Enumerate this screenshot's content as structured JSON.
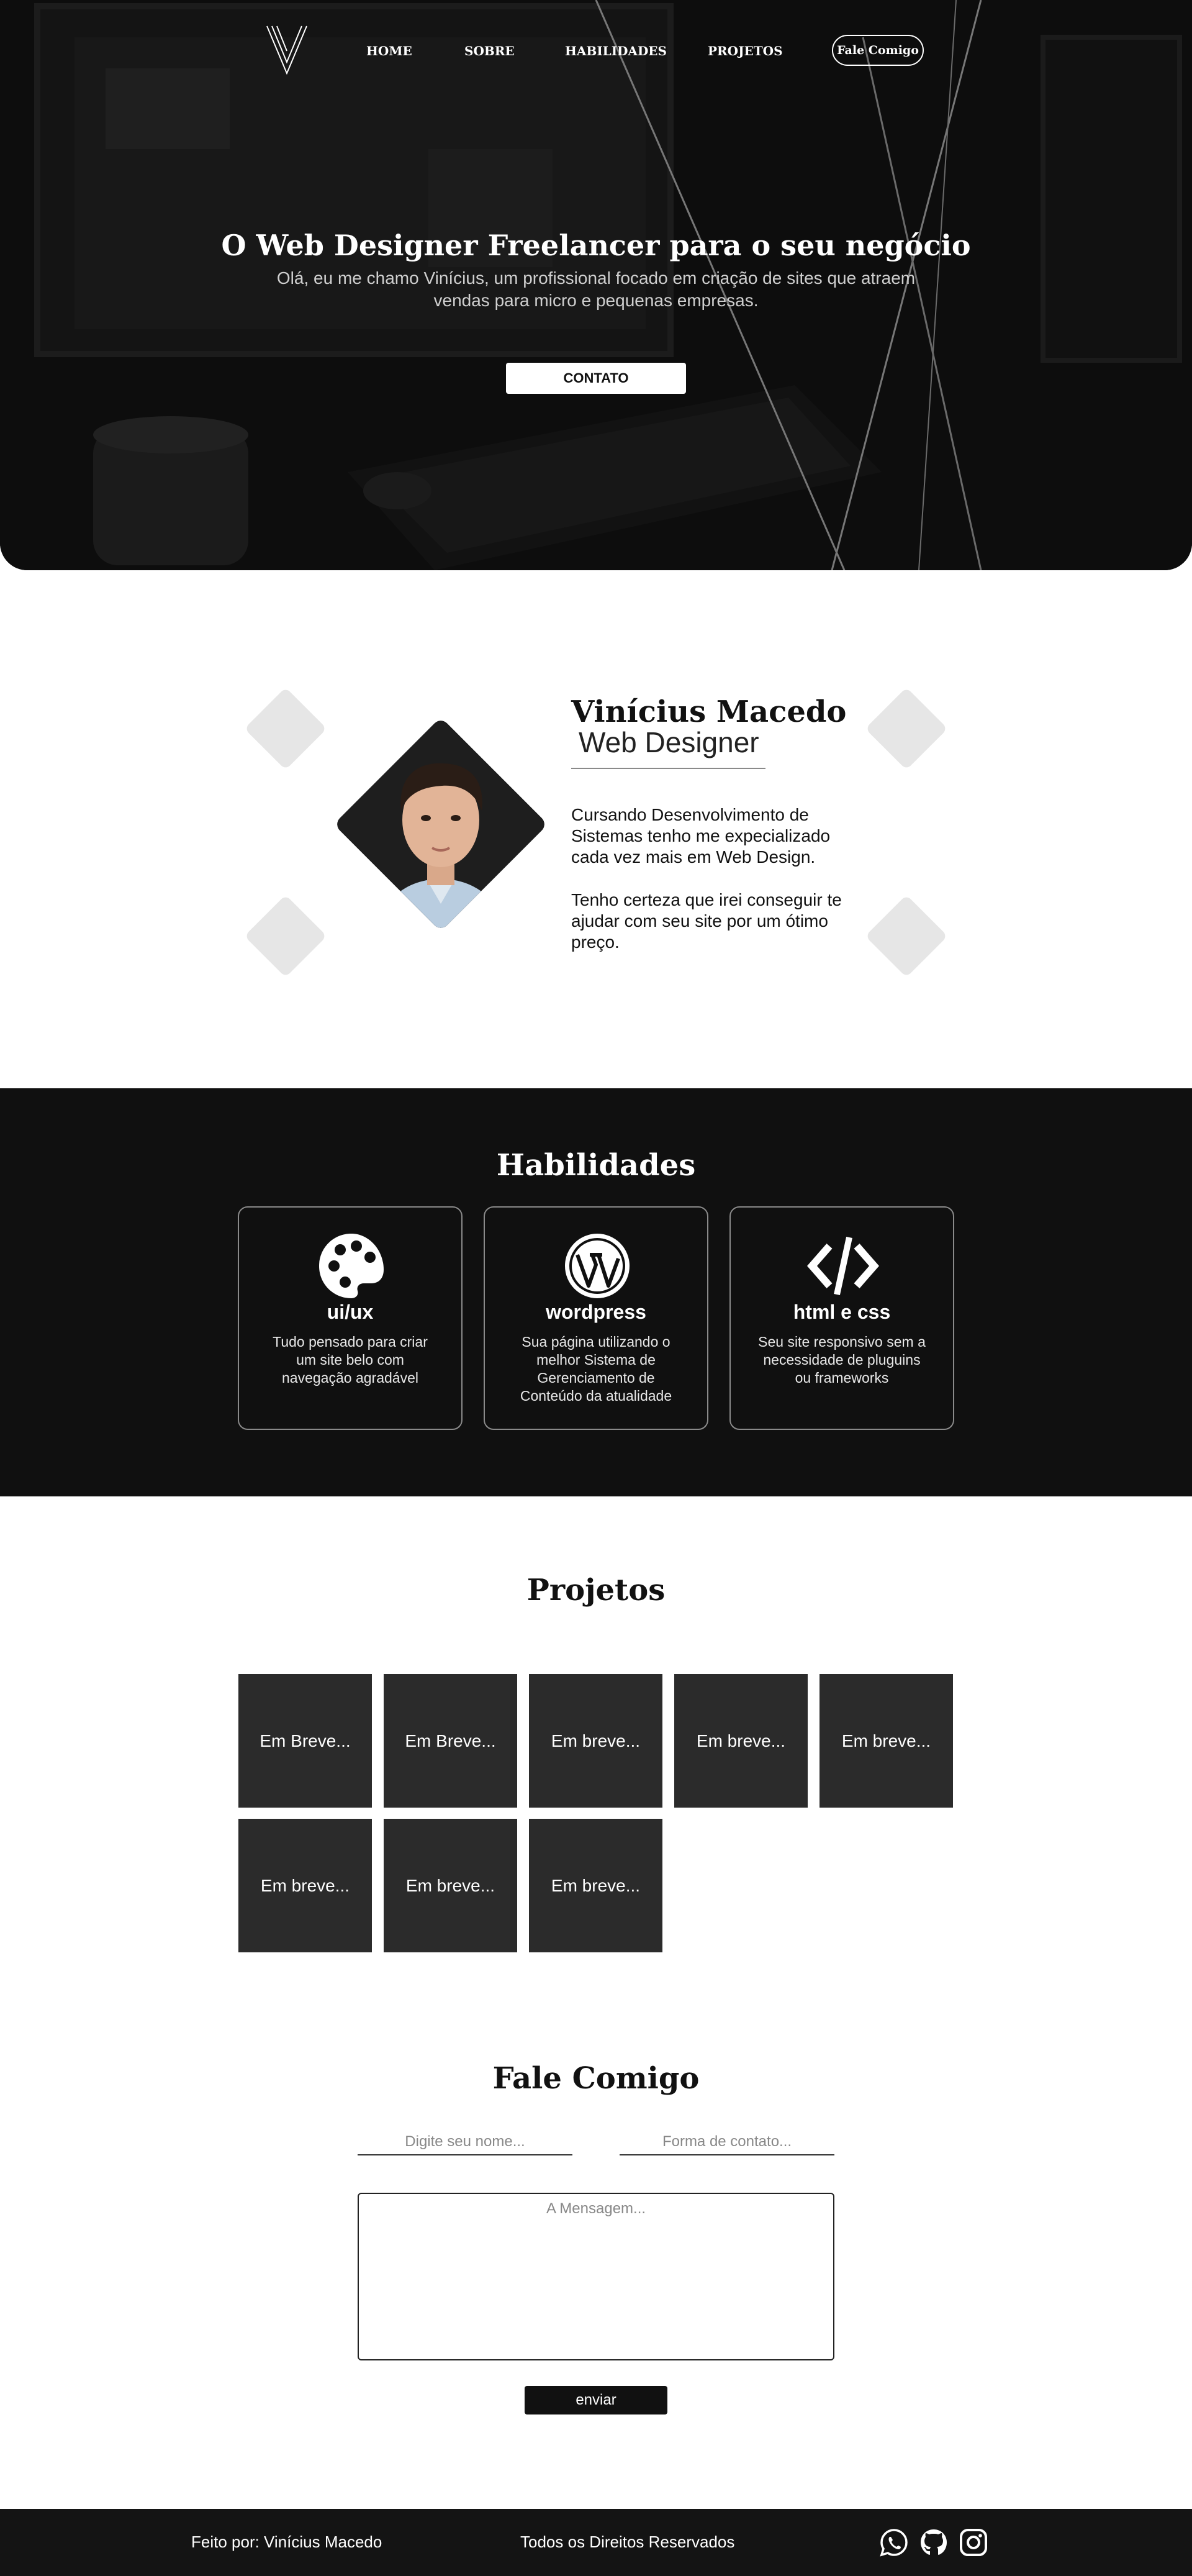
{
  "nav": {
    "links": [
      "HOME",
      "SOBRE",
      "HABILIDADES",
      "PROJETOS"
    ],
    "cta": "Fale Comigo"
  },
  "hero": {
    "title": "O Web Designer Freelancer para o seu negócio",
    "subtitle": "Olá, eu me chamo Vinícius, um profissional focado em criação de sites que atraem vendas para micro e pequenas empresas.",
    "button": "CONTATO"
  },
  "about": {
    "name": "Vinícius Macedo",
    "role": "Web Designer",
    "paragraphs": [
      "Cursando Desenvolvimento de Sistemas tenho me expecializado cada vez mais em Web Design.",
      "Tenho certeza que irei conseguir te ajudar com seu site por um ótimo preço."
    ]
  },
  "skills": {
    "title": "Habilidades",
    "items": [
      {
        "name": "ui/ux",
        "icon": "palette-icon",
        "desc": "Tudo pensado para criar um site belo com navegação agradável"
      },
      {
        "name": "wordpress",
        "icon": "wordpress-icon",
        "desc": "Sua página utilizando o melhor Sistema de Gerenciamento de Conteúdo da atualidade"
      },
      {
        "name": "html e css",
        "icon": "code-icon",
        "desc": "Seu site responsivo sem a necessidade de pluguins ou frameworks"
      }
    ]
  },
  "projects": {
    "title": "Projetos",
    "items": [
      "Em Breve...",
      "Em Breve...",
      "Em breve...",
      "Em breve...",
      "Em breve...",
      "Em breve...",
      "Em breve...",
      "Em breve..."
    ]
  },
  "contact": {
    "title": "Fale Comigo",
    "name_placeholder": "Digite seu nome...",
    "contact_placeholder": "Forma de contato...",
    "message_placeholder": "A Mensagem...",
    "send": "enviar"
  },
  "footer": {
    "author": "Feito por: Vinícius Macedo",
    "rights": "Todos os Direitos Reservados",
    "social": [
      "whatsapp-icon",
      "github-icon",
      "instagram-icon"
    ]
  },
  "colors": {
    "dark": "#101010",
    "tile": "#2b2b2b",
    "deco": "#e6e6e6",
    "white": "#ffffff"
  }
}
